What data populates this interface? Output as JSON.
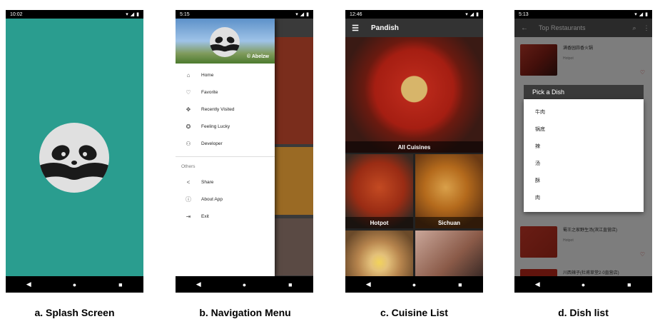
{
  "splash": {
    "status_time": "10:02",
    "caption": "a. Splash Screen",
    "colors": {
      "background": "#2a9d8f",
      "logo": "#e0e0e0"
    },
    "nav_icons": [
      "back-icon",
      "home-icon",
      "recents-icon"
    ]
  },
  "navmenu": {
    "status_time": "5:15",
    "header_credit": "© Abelzw",
    "items": [
      {
        "label": "Home",
        "icon": "home-icon"
      },
      {
        "label": "Favorite",
        "icon": "heart-icon"
      },
      {
        "label": "Recently Visited",
        "icon": "gamepad-icon"
      },
      {
        "label": "Feeling Lucky",
        "icon": "wheel-icon"
      },
      {
        "label": "Developer",
        "icon": "people-icon"
      }
    ],
    "section_others": "Others",
    "others": [
      {
        "label": "Share",
        "icon": "share-icon"
      },
      {
        "label": "About App",
        "icon": "info-icon"
      },
      {
        "label": "Exit",
        "icon": "exit-icon"
      }
    ],
    "caption": "b. Navigation Menu"
  },
  "cuisine": {
    "status_time": "12:46",
    "app_title": "Pandish",
    "tiles": {
      "all": "All Cuisines",
      "hotpot": "Hotpot",
      "sichuan": "Sichuan"
    },
    "caption": "c. Cuisine List"
  },
  "dishlist": {
    "status_time": "5:13",
    "title": "Top Restaurants",
    "restaurants": [
      {
        "name": "满香园蒜香火锅",
        "category": "Hotpot"
      },
      {
        "name": "蜀王之家野生汤(滨江直营店)",
        "category": "Hotpot"
      },
      {
        "name": "川西辣子(杜甫草堂2·0直营店)",
        "category": ""
      }
    ],
    "dialog_title": "Pick a Dish",
    "dishes": [
      "牛肉",
      "锅底",
      "辣",
      "汤",
      "酥",
      "肉"
    ],
    "caption": "d. Dish list"
  }
}
